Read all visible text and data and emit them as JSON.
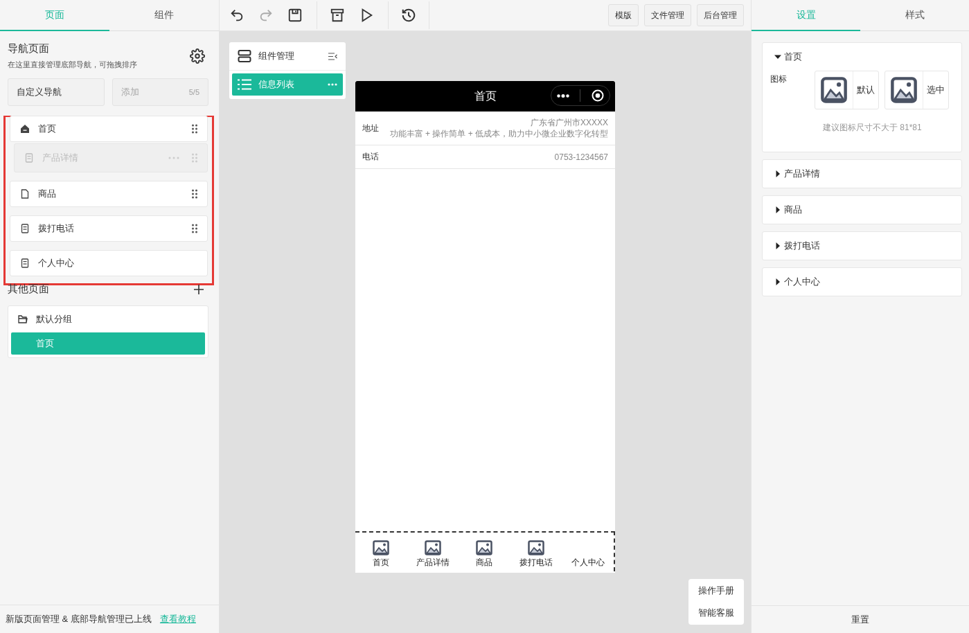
{
  "left_tabs": [
    {
      "label": "页面",
      "selected": true
    },
    {
      "label": "组件",
      "selected": false
    }
  ],
  "nav": {
    "title": "导航页面",
    "subtitle": "在这里直接管理底部导航，可拖拽排序",
    "custom_button": "自定义导航",
    "add_button": {
      "label": "添加",
      "count": "5/5",
      "disabled": true
    },
    "highlighted": true,
    "items": [
      {
        "label": "首页",
        "kind": "home",
        "draggable": true,
        "dragging": false
      },
      {
        "label": "产品详情",
        "kind": "form",
        "draggable": true,
        "dragging": true
      },
      {
        "label": "商品",
        "kind": "file",
        "draggable": true,
        "dragging": false
      },
      {
        "label": "拨打电话",
        "kind": "form",
        "draggable": true,
        "dragging": false
      },
      {
        "label": "个人中心",
        "kind": "form",
        "draggable": false,
        "dragging": false
      }
    ]
  },
  "other_pages": {
    "title": "其他页面",
    "group": "默认分组",
    "pages": [
      {
        "label": "首页",
        "selected": true
      }
    ]
  },
  "footer": {
    "notice": "新版页面管理 & 底部导航管理已上线",
    "link": "查看教程"
  },
  "toolbar": {
    "tools": [
      {
        "kind": "undo",
        "disabled": false
      },
      {
        "kind": "redo",
        "disabled": true
      },
      {
        "kind": "save",
        "disabled": false
      },
      {
        "kind": "archive",
        "disabled": false
      },
      {
        "kind": "play",
        "disabled": false
      },
      {
        "kind": "history",
        "disabled": false
      }
    ],
    "buttons": [
      "模版",
      "文件管理",
      "后台管理"
    ]
  },
  "component_panel": {
    "title": "组件管理",
    "items": [
      {
        "label": "信息列表",
        "selected": true
      }
    ]
  },
  "phone": {
    "title": "首页",
    "rows": [
      {
        "label": "地址",
        "lines": [
          "广东省广州市XXXXX",
          "功能丰富 + 操作简单 + 低成本，助力中小微企业数字化转型"
        ]
      },
      {
        "label": "电话",
        "lines": [
          "0753-1234567"
        ]
      }
    ],
    "tabbar": [
      {
        "label": "首页",
        "has_icon": true
      },
      {
        "label": "产品详情",
        "has_icon": true
      },
      {
        "label": "商品",
        "has_icon": true
      },
      {
        "label": "拨打电话",
        "has_icon": true
      },
      {
        "label": "个人中心",
        "has_icon": false
      }
    ]
  },
  "help": [
    "操作手册",
    "智能客服"
  ],
  "right_tabs": [
    {
      "label": "设置",
      "selected": true
    },
    {
      "label": "样式",
      "selected": false
    }
  ],
  "settings": [
    {
      "label": "首页",
      "expanded": true,
      "icon_label": "图标",
      "default_label": "默认",
      "selected_label": "选中",
      "hint": "建议图标尺寸不大于 81*81"
    },
    {
      "label": "产品详情",
      "expanded": false
    },
    {
      "label": "商品",
      "expanded": false
    },
    {
      "label": "拨打电话",
      "expanded": false
    },
    {
      "label": "个人中心",
      "expanded": false
    }
  ],
  "reset_button": "重置"
}
